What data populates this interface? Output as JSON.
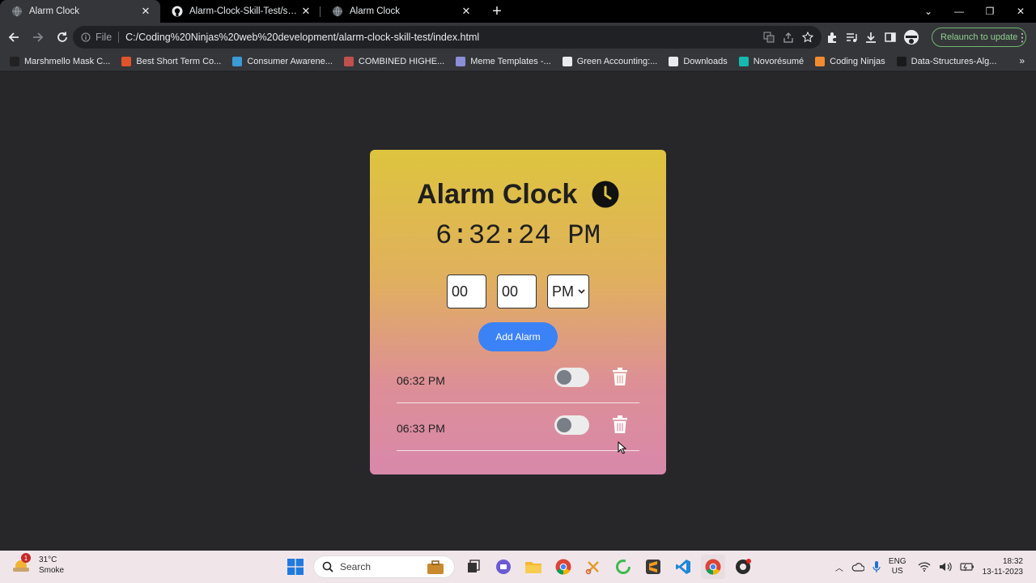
{
  "browser": {
    "tabs": [
      {
        "title": "Alarm Clock",
        "active": true
      },
      {
        "title": "Alarm-Clock-Skill-Test/script.js a",
        "active": false
      },
      {
        "title": "Alarm Clock",
        "active": false
      }
    ],
    "omnibox": {
      "scheme_label": "File",
      "url": "C:/Coding%20Ninjas%20web%20development/alarm-clock-skill-test/index.html"
    },
    "relaunch_label": "Relaunch to update",
    "bookmarks": [
      {
        "label": "Marshmello Mask C...",
        "color": "#222222"
      },
      {
        "label": "Best Short Term Co...",
        "color": "#e0542b"
      },
      {
        "label": "Consumer Awarene...",
        "color": "#3a9bd5"
      },
      {
        "label": "COMBINED HIGHE...",
        "color": "#c0504d"
      },
      {
        "label": "Meme Templates -...",
        "color": "#8a8fd8"
      },
      {
        "label": "Green Accounting:...",
        "color": "#e8eaed"
      },
      {
        "label": "Downloads",
        "color": "#e8eaed"
      },
      {
        "label": "Novorésumé",
        "color": "#17b8b0"
      },
      {
        "label": "Coding Ninjas",
        "color": "#f28b30"
      },
      {
        "label": "Data-Structures-Alg...",
        "color": "#1a1a1a"
      }
    ]
  },
  "app": {
    "title": "Alarm Clock",
    "current_time": "6:32:24 PM",
    "hour_value": "00",
    "minute_value": "00",
    "ampm_value": "PM",
    "add_button": "Add Alarm",
    "alarms": [
      {
        "time": "06:32 PM",
        "enabled": false
      },
      {
        "time": "06:33 PM",
        "enabled": false
      }
    ]
  },
  "taskbar": {
    "weather_temp": "31°C",
    "weather_desc": "Smoke",
    "weather_badge": "1",
    "search_label": "Search",
    "lang_top": "ENG",
    "lang_bottom": "US",
    "time": "18:32",
    "date": "13-11-2023"
  }
}
